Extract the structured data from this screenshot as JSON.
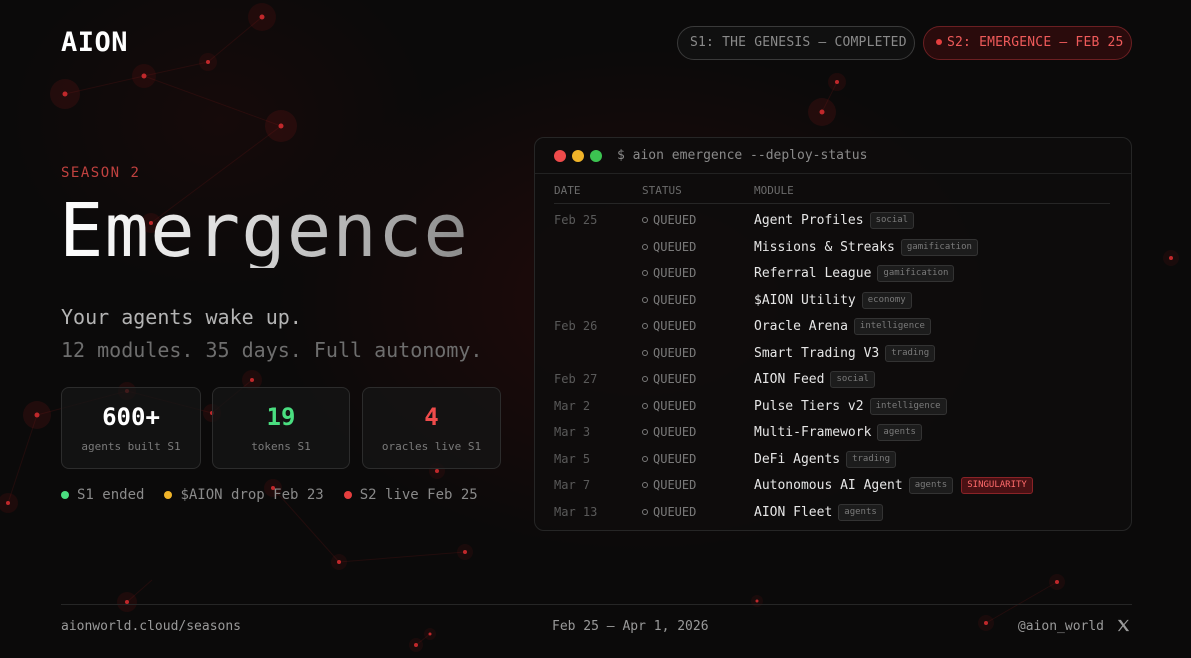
{
  "brand": {
    "logo": "AION"
  },
  "header": {
    "season1_pill": "S1: THE GENESIS — COMPLETED",
    "season2_pill": "S2: EMERGENCE — FEB 25"
  },
  "hero": {
    "season_label": "SEASON 2",
    "headline": "Emergence",
    "tagline": "Your agents wake up.",
    "subtagline": "12 modules. 35 days. Full autonomy."
  },
  "stats": [
    {
      "value": "600+",
      "label": "agents built S1",
      "color": "#ffffff"
    },
    {
      "value": "19",
      "label": "tokens S1",
      "color": "#4ade80"
    },
    {
      "value": "4",
      "label": "oracles live S1",
      "color": "#ef4b4b"
    }
  ],
  "timeline_legend": [
    {
      "label": "S1 ended",
      "color": "#4ade80"
    },
    {
      "label": "$AION drop Feb 23",
      "color": "#f0b429"
    },
    {
      "label": "S2 live Feb 25",
      "color": "#e53e3e"
    }
  ],
  "terminal": {
    "command": "$ aion emergence --deploy-status",
    "traffic_lights": [
      "#ee4b4b",
      "#f0b429",
      "#3cc451"
    ],
    "columns": {
      "date": "DATE",
      "status": "STATUS",
      "module": "MODULE"
    },
    "rows": [
      {
        "date": "Feb 25",
        "status": "QUEUED",
        "module": "Agent Profiles",
        "tag": "social"
      },
      {
        "date": "",
        "status": "QUEUED",
        "module": "Missions & Streaks",
        "tag": "gamification"
      },
      {
        "date": "",
        "status": "QUEUED",
        "module": "Referral League",
        "tag": "gamification"
      },
      {
        "date": "",
        "status": "QUEUED",
        "module": "$AION Utility",
        "tag": "economy"
      },
      {
        "date": "Feb 26",
        "status": "QUEUED",
        "module": "Oracle Arena",
        "tag": "intelligence"
      },
      {
        "date": "",
        "status": "QUEUED",
        "module": "Smart Trading V3",
        "tag": "trading"
      },
      {
        "date": "Feb 27",
        "status": "QUEUED",
        "module": "AION Feed",
        "tag": "social"
      },
      {
        "date": "Mar 2",
        "status": "QUEUED",
        "module": "Pulse Tiers v2",
        "tag": "intelligence"
      },
      {
        "date": "Mar 3",
        "status": "QUEUED",
        "module": "Multi-Framework",
        "tag": "agents"
      },
      {
        "date": "Mar 5",
        "status": "QUEUED",
        "module": "DeFi Agents",
        "tag": "trading"
      },
      {
        "date": "Mar 7",
        "status": "QUEUED",
        "module": "Autonomous AI Agent",
        "tag": "agents",
        "highlight": "SINGULARITY"
      },
      {
        "date": "Mar 13",
        "status": "QUEUED",
        "module": "AION Fleet",
        "tag": "agents"
      }
    ]
  },
  "footer": {
    "url": "aionworld.cloud/seasons",
    "dates": "Feb 25 — Apr 1, 2026",
    "handle": "@aion_world",
    "social_icon": "x-icon"
  }
}
